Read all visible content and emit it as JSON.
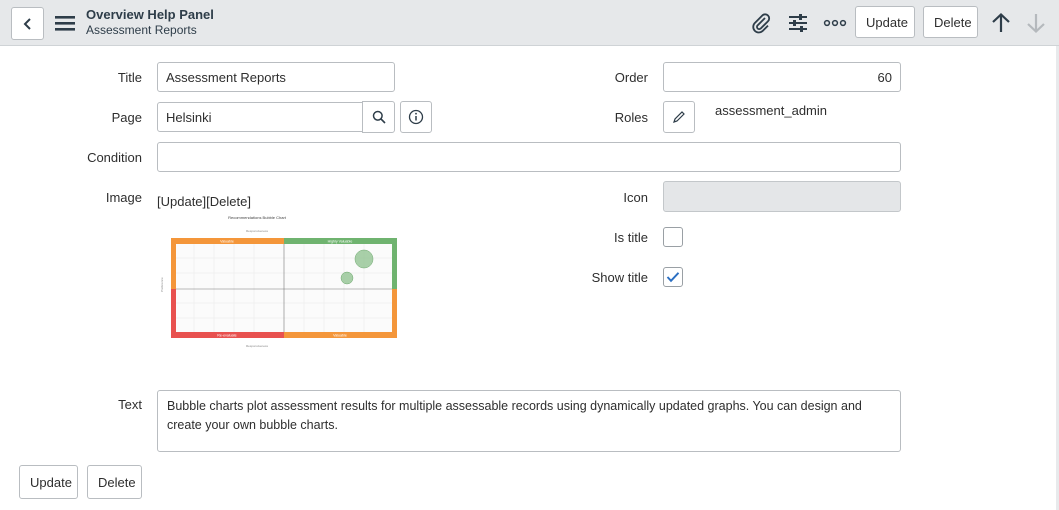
{
  "header": {
    "title": "Overview Help Panel",
    "subtitle": "Assessment Reports",
    "update_label": "Update",
    "delete_label": "Delete",
    "icons": [
      "back-icon",
      "menu-icon",
      "paperclip-icon",
      "sliders-icon",
      "more-icon",
      "arrow-up-icon",
      "arrow-down-icon"
    ]
  },
  "form": {
    "title_label": "Title",
    "title_value": "Assessment Reports",
    "page_label": "Page",
    "page_value": "Helsinki",
    "condition_label": "Condition",
    "condition_value": "",
    "image_label": "Image",
    "image_update": "[Update]",
    "image_delete": "[Delete]",
    "order_label": "Order",
    "order_value": "60",
    "roles_label": "Roles",
    "roles_value": "assessment_admin",
    "icon_label": "Icon",
    "icon_value": "",
    "is_title_label": "Is title",
    "is_title_checked": false,
    "show_title_label": "Show title",
    "show_title_checked": true,
    "text_label": "Text",
    "text_value": "Bubble charts plot assessment results for multiple assessable records using dynamically updated graphs. You can design and create your own bubble charts."
  },
  "image_preview": {
    "chart_title": "Recommendations Bubble Chart",
    "top_left": "Valuable",
    "top_right": "Highly Valuable",
    "bottom_left": "Re-evaluate",
    "bottom_right": "Valuable"
  },
  "footer": {
    "update_label": "Update",
    "delete_label": "Delete"
  },
  "colors": {
    "header_bg": "#e6e8ea",
    "accent_check": "#2b6fc2",
    "quadrant_green": "#6fb36f",
    "quadrant_orange": "#f4963a",
    "quadrant_red": "#e8514f"
  }
}
